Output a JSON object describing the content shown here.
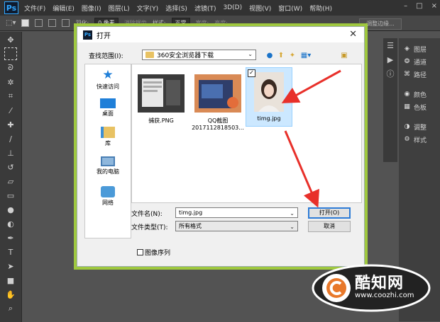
{
  "app": {
    "logo": "Ps"
  },
  "menu": [
    "文件(F)",
    "编辑(E)",
    "图像(I)",
    "图层(L)",
    "文字(Y)",
    "选择(S)",
    "滤镜(T)",
    "3D(D)",
    "视图(V)",
    "窗口(W)",
    "帮助(H)"
  ],
  "window_controls": [
    "–",
    "□",
    "×"
  ],
  "options_bar": {
    "feather_label": "羽化:",
    "feather_value": "0 像素",
    "antialias": "消除锯齿",
    "style_label": "样式:",
    "style_value": "正常",
    "width_label": "宽度:",
    "height_label": "高度:",
    "refine_edge": "调整边缘..."
  },
  "right_panel": [
    {
      "icon": "layers-icon",
      "label": "图层"
    },
    {
      "icon": "channels-icon",
      "label": "通道"
    },
    {
      "icon": "paths-icon",
      "label": "路径"
    },
    {
      "icon": "color-icon",
      "label": "颜色"
    },
    {
      "icon": "swatches-icon",
      "label": "色板"
    },
    {
      "icon": "adjustments-icon",
      "label": "调整"
    },
    {
      "icon": "styles-icon",
      "label": "样式"
    }
  ],
  "dialog": {
    "title": "打开",
    "look_in_label": "查找范围(I):",
    "look_in_value": "360安全浏览器下载",
    "places": [
      "快速访问",
      "桌面",
      "库",
      "我的电脑",
      "网络"
    ],
    "files": [
      {
        "name": "捕获.PNG",
        "name2": ""
      },
      {
        "name": "QQ截图",
        "name2": "2017112818503..."
      },
      {
        "name": "timg.jpg",
        "name2": ""
      }
    ],
    "filename_label": "文件名(N):",
    "filename_value": "timg.jpg",
    "filetype_label": "文件类型(T):",
    "filetype_value": "所有格式",
    "open_button": "打开(O)",
    "cancel_button": "取消",
    "image_sequence": "图像序列"
  },
  "watermark": {
    "text": "酷知网",
    "url": "www.coozhi.com"
  },
  "colors": {
    "accent_border": "#9fc83f",
    "arrow": "#e8302a",
    "selection": "#cce8ff"
  }
}
